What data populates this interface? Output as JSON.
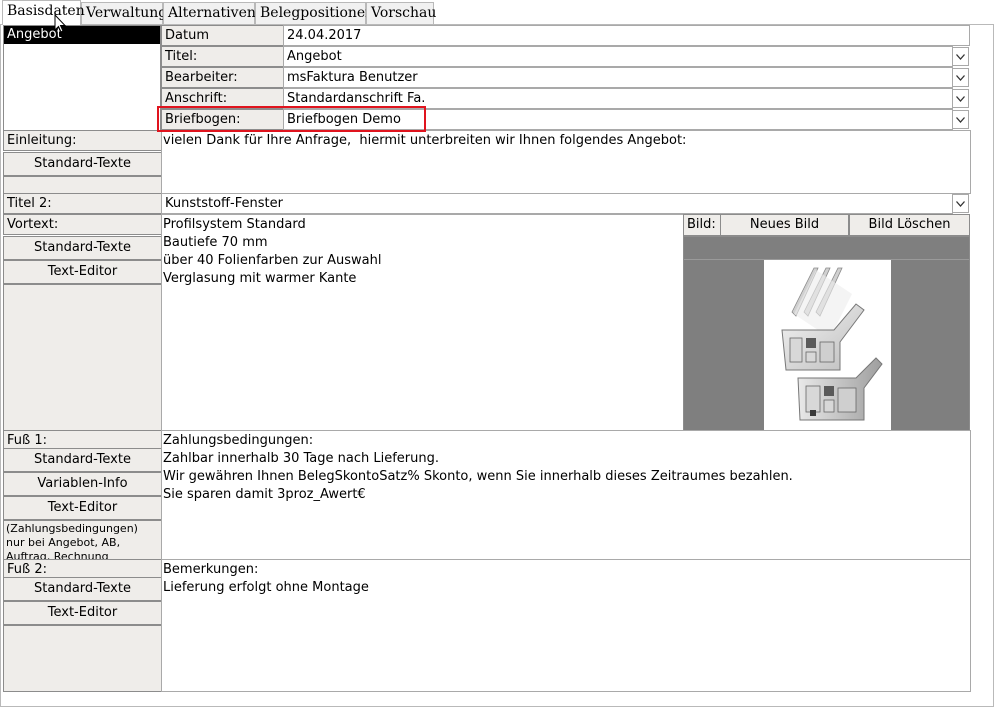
{
  "tabs": [
    "Basisdaten",
    "Verwaltung",
    "Alternativen",
    "Belegpositionen",
    "Vorschau"
  ],
  "doc_type": "Angebot",
  "fields": {
    "datum_label": "Datum",
    "datum_value": "24.04.2017",
    "titel_label": "Titel:",
    "titel_value": "Angebot",
    "bearbeiter_label": "Bearbeiter:",
    "bearbeiter_value": "msFaktura Benutzer",
    "anschrift_label": "Anschrift:",
    "anschrift_value": "Standardanschrift Fa.",
    "briefbogen_label": "Briefbogen:",
    "briefbogen_value": "Briefbogen Demo"
  },
  "einleitung": {
    "label": "Einleitung:",
    "button": "Standard-Texte",
    "text": "vielen Dank für Ihre Anfrage,  hiermit unterbreiten wir Ihnen folgendes Angebot:"
  },
  "titel2": {
    "label": "Titel 2:",
    "value": "Kunststoff-Fenster"
  },
  "vortext": {
    "label": "Vortext:",
    "buttons": [
      "Standard-Texte",
      "Text-Editor"
    ],
    "lines": [
      "Profilsystem Standard",
      "Bautiefe 70 mm",
      "über 40 Folienfarben zur Auswahl",
      "Verglasung mit warmer Kante"
    ]
  },
  "bild": {
    "label": "Bild:",
    "new_button": "Neues Bild",
    "delete_button": "Bild Löschen",
    "image_icon": "window-profile-image"
  },
  "fuss1": {
    "label": "Fuß 1:",
    "buttons": [
      "Standard-Texte",
      "Variablen-Info",
      "Text-Editor"
    ],
    "note": "(Zahlungsbedingungen)\nnur bei Angebot, AB,\nAuftrag, Rechnung",
    "lines": [
      "Zahlungsbedingungen:",
      "Zahlbar innerhalb 30 Tage nach Lieferung.",
      "Wir gewähren Ihnen BelegSkontoSatz% Skonto, wenn Sie innerhalb dieses Zeitraumes bezahlen.",
      "Sie sparen damit 3proz_Awert€"
    ]
  },
  "fuss2": {
    "label": "Fuß 2:",
    "buttons": [
      "Standard-Texte",
      "Text-Editor"
    ],
    "lines": [
      "Bemerkungen:",
      "Lieferung erfolgt ohne Montage"
    ]
  },
  "colors": {
    "highlight": "#e0141e",
    "panel": "#efedea",
    "selection": "#000000",
    "image_bg": "#7f7f7f"
  }
}
